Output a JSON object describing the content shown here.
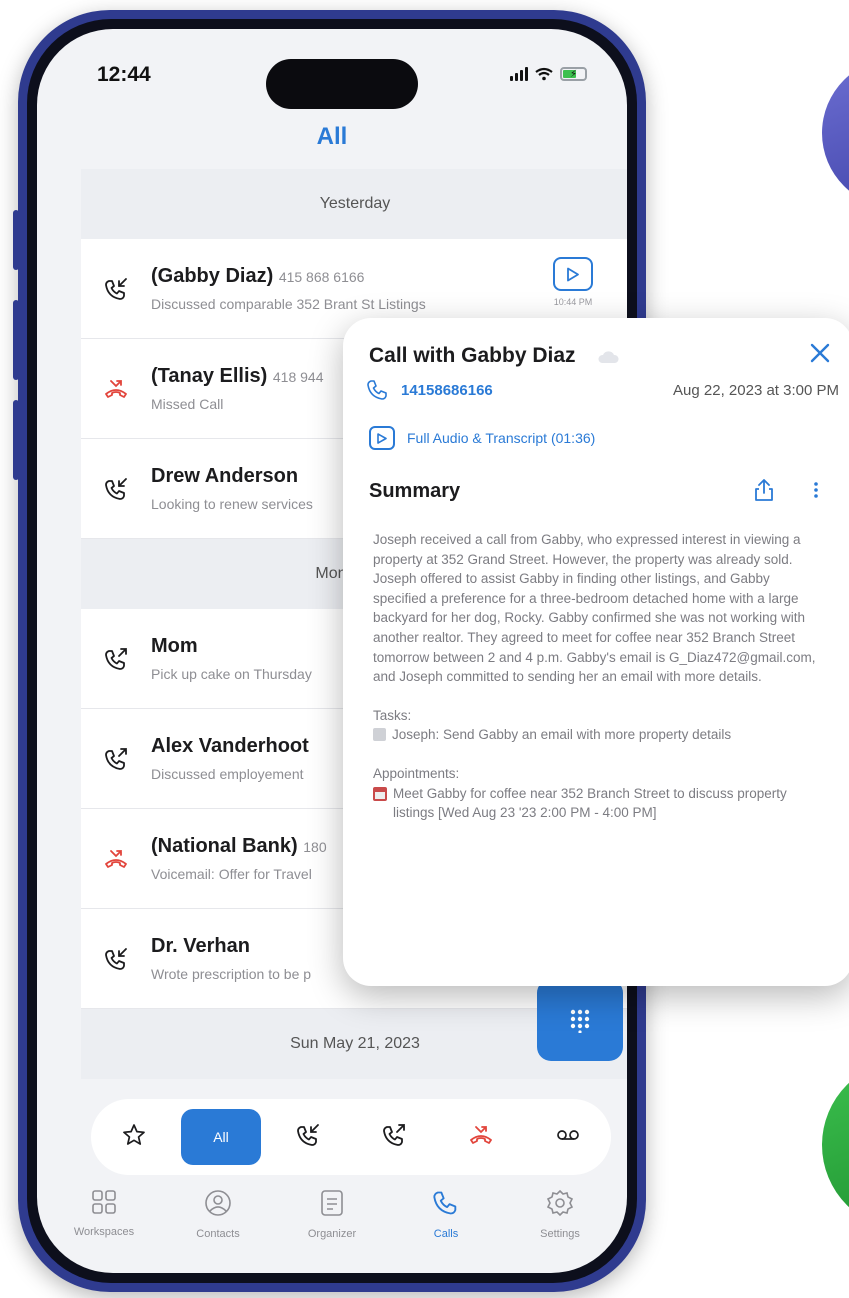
{
  "status": {
    "time": "12:44",
    "battery_icon": "battery-charging-icon"
  },
  "header": {
    "title": "All"
  },
  "sections": [
    {
      "label": "Yesterday",
      "rows": [
        {
          "name": "(Gabby Diaz)",
          "number": "415 868 6166",
          "sub": "Discussed comparable 352 Brant St Listings",
          "icon": "incoming-call-icon",
          "missed": false,
          "play_time": "10:44 PM"
        },
        {
          "name": "(Tanay Ellis)",
          "number": "418 944",
          "sub": "Missed Call",
          "icon": "missed-call-icon",
          "missed": true
        },
        {
          "name": "Drew Anderson",
          "number": "",
          "sub": "Looking to renew services",
          "icon": "incoming-call-icon",
          "missed": false
        }
      ]
    },
    {
      "label": "Mon May 2",
      "rows": [
        {
          "name": "Mom",
          "number": "",
          "sub": "Pick up cake on Thursday",
          "icon": "outgoing-call-icon",
          "missed": false
        },
        {
          "name": "Alex Vanderhoot",
          "number": "",
          "sub": "Discussed employement",
          "icon": "outgoing-call-icon",
          "missed": false
        },
        {
          "name": "(National Bank)",
          "number": "180",
          "sub": "Voicemail: Offer for Travel",
          "icon": "missed-call-icon",
          "missed": true
        },
        {
          "name": "Dr. Verhan",
          "number": "",
          "sub": "Wrote prescription to be p",
          "icon": "incoming-call-icon",
          "missed": false
        }
      ]
    },
    {
      "label": "Sun May 21, 2023",
      "rows": []
    }
  ],
  "filters": [
    {
      "name": "favorites",
      "icon": "star-icon",
      "label": ""
    },
    {
      "name": "all",
      "icon": "",
      "label": "All",
      "active": true
    },
    {
      "name": "incoming",
      "icon": "incoming-call-icon",
      "label": ""
    },
    {
      "name": "outgoing",
      "icon": "outgoing-call-icon",
      "label": ""
    },
    {
      "name": "missed",
      "icon": "missed-call-icon",
      "label": ""
    },
    {
      "name": "voicemail",
      "icon": "voicemail-icon",
      "label": ""
    }
  ],
  "tabs": [
    {
      "label": "Workspaces",
      "icon": "grid-icon"
    },
    {
      "label": "Contacts",
      "icon": "user-circle-icon"
    },
    {
      "label": "Organizer",
      "icon": "document-icon"
    },
    {
      "label": "Calls",
      "icon": "phone-icon",
      "active": true
    },
    {
      "label": "Settings",
      "icon": "gear-icon"
    }
  ],
  "card": {
    "title": "Call with Gabby Diaz",
    "phone": "14158686166",
    "date": "Aug 22, 2023 at 3:00 PM",
    "audio_label": "Full Audio & Transcript (01:36)",
    "summary_title": "Summary",
    "summary": "Joseph received a call from Gabby, who expressed interest in viewing a property at 352 Grand Street. However, the property was already sold. Joseph offered to assist Gabby in finding other listings, and Gabby specified a preference for a three-bedroom detached home with a large backyard for her dog, Rocky. Gabby confirmed she was not working with another realtor. They agreed to meet for coffee near 352 Branch Street tomorrow between 2 and 4 p.m. Gabby's email is G_Diaz472@gmail.com, and Joseph committed to sending her an email with more details.",
    "tasks_label": "Tasks:",
    "task": "Joseph: Send Gabby an email with more property details",
    "appointments_label": "Appointments:",
    "appointment": "Meet Gabby for coffee near 352 Branch Street to discuss property listings [Wed Aug 23 '23 2:00 PM - 4:00 PM]"
  },
  "colors": {
    "accent": "#2a7ad6",
    "missed": "#e2453c",
    "frame": "#2f3b8f"
  }
}
